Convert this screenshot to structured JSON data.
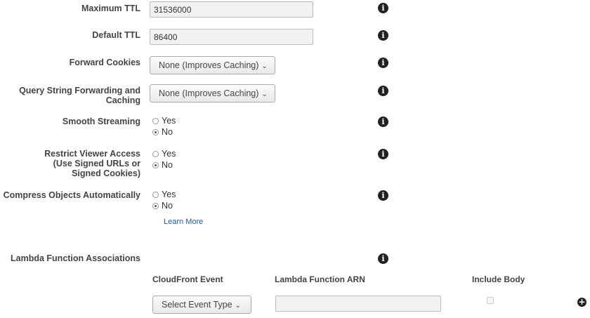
{
  "settings": {
    "max_ttl": {
      "label": "Maximum TTL",
      "value": "31536000"
    },
    "default_ttl": {
      "label": "Default TTL",
      "value": "86400"
    },
    "forward_cookies": {
      "label": "Forward Cookies",
      "selected": "None (Improves Caching)"
    },
    "query_string": {
      "label_line1": "Query String Forwarding and",
      "label_line2": "Caching",
      "selected": "None (Improves Caching)"
    },
    "smooth_streaming": {
      "label": "Smooth Streaming",
      "yes": "Yes",
      "no": "No",
      "value": "No"
    },
    "restrict_viewer": {
      "label_line1": "Restrict Viewer Access",
      "label_line2": "(Use Signed URLs or",
      "label_line3": "Signed Cookies)",
      "yes": "Yes",
      "no": "No",
      "value": "No"
    },
    "compress": {
      "label": "Compress Objects Automatically",
      "yes": "Yes",
      "no": "No",
      "value": "No",
      "learn_more": "Learn More"
    }
  },
  "lambda": {
    "label": "Lambda Function Associations",
    "col_event": "CloudFront Event",
    "col_arn": "Lambda Function ARN",
    "col_body": "Include Body",
    "event_select": "Select Event Type",
    "arn_value": "",
    "include_body": false
  },
  "icons": {
    "info": "info-icon",
    "add": "plus-circle-icon",
    "dropdown": "chevron-down-icon"
  },
  "colors": {
    "link": "#1b5ea6",
    "input_bg": "#f3f2f0"
  }
}
